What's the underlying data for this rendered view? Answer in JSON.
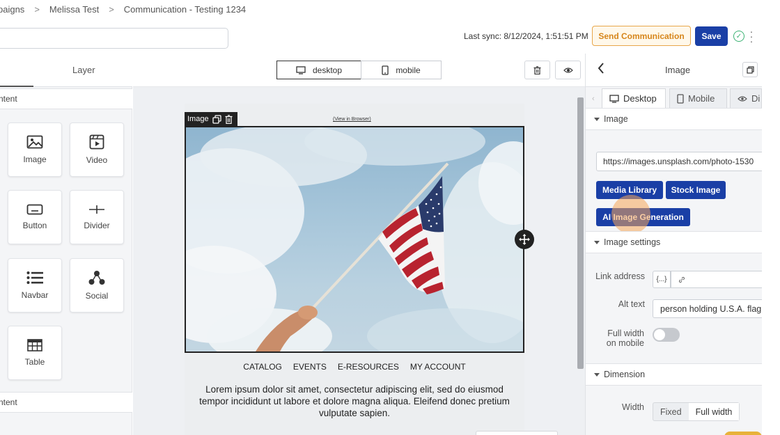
{
  "breadcrumb": {
    "items": [
      "paigns",
      "Melissa Test",
      "Communication - Testing 1234"
    ],
    "separator": ">"
  },
  "topbar": {
    "sync_text": "Last sync: 8/12/2024, 1:51:51 PM",
    "send_label": "Send Communication",
    "save_label": "Save"
  },
  "left": {
    "tab_layer": "Layer",
    "section_content": "ntent",
    "section_content2": "ntent",
    "blocks": [
      "Image",
      "Video",
      "Button",
      "Divider",
      "Navbar",
      "Social",
      "Table"
    ]
  },
  "canvas": {
    "device_desktop": "desktop",
    "device_mobile": "mobile",
    "view_in_browser": "(View in Browser)",
    "image_tag": "Image",
    "nav_links": [
      "CATALOG",
      "EVENTS",
      "E-RESOURCES",
      "MY ACCOUNT"
    ],
    "lorem": "Lorem ipsum dolor sit amet, consectetur adipiscing elit, sed do eiusmod tempor incididunt ut labore et dolore magna aliqua. Eleifend donec pretium vulputate sapien."
  },
  "right": {
    "title": "Image",
    "tab_desktop": "Desktop",
    "tab_mobile": "Mobile",
    "tab_third": "Di",
    "section_image": "Image",
    "image_url": "https://images.unsplash.com/photo-1530",
    "btn_media": "Media Library",
    "btn_stock": "Stock Image",
    "btn_ai": "AI Image Generation",
    "section_settings": "Image settings",
    "link_label": "Link address",
    "var_label": "{...}",
    "alt_label": "Alt text",
    "alt_value": "person holding U.S.A. flag",
    "fullwidth_label_1": "Full width",
    "fullwidth_label_2": "on mobile",
    "fullwidth_on": false,
    "section_dimension": "Dimension",
    "width_label": "Width",
    "width_options": [
      "Fixed",
      "Full width"
    ],
    "width_selected": "Full width"
  },
  "colors": {
    "primary": "#1a3fa6",
    "send_accent": "#d6851a",
    "success": "#3bb273"
  }
}
